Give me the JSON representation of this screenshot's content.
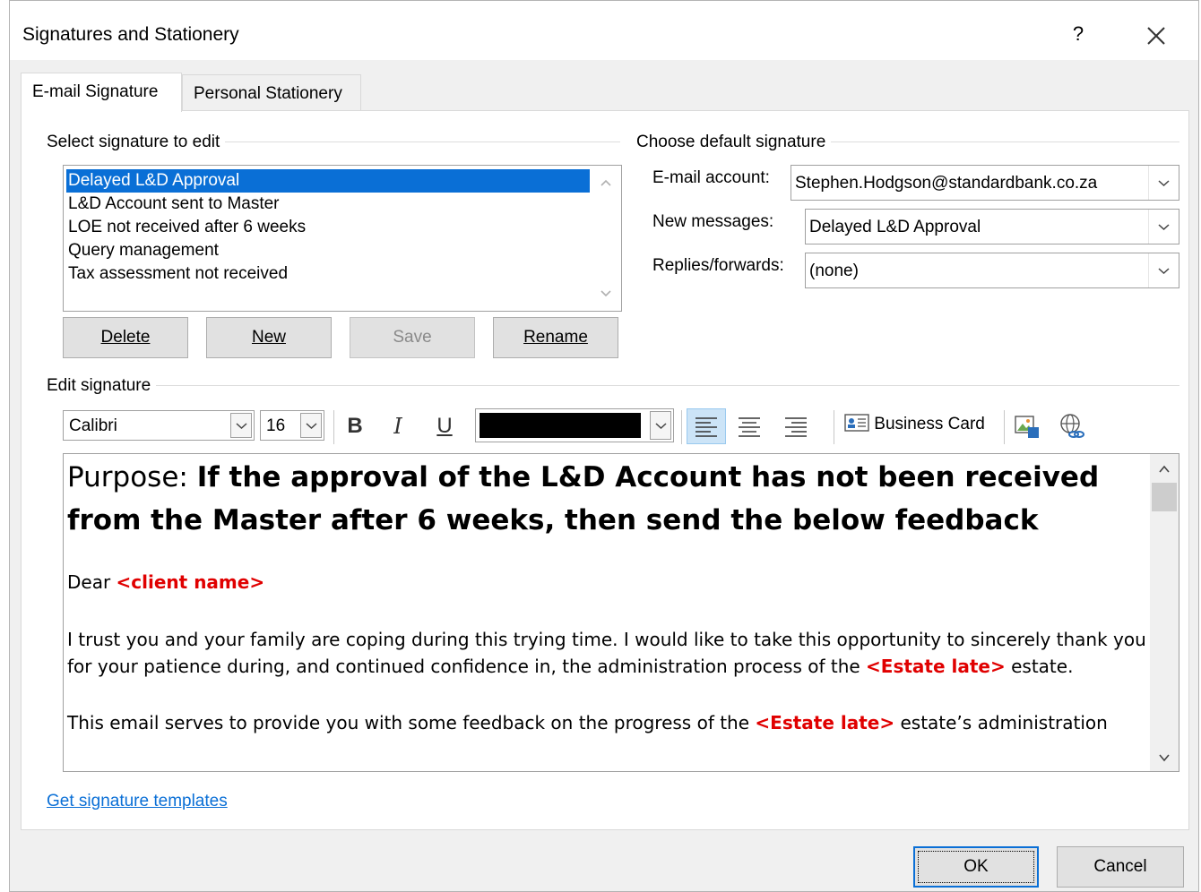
{
  "window": {
    "title": "Signatures and Stationery",
    "help_label": "?"
  },
  "tabs": [
    {
      "label": "E-mail Signature"
    },
    {
      "label": "Personal Stationery"
    }
  ],
  "select_signature": {
    "group_label": "Select signature to edit",
    "items": [
      {
        "label": "Delayed L&D Approval",
        "selected": true
      },
      {
        "label": "L&D Account sent to Master"
      },
      {
        "label": "LOE not received after 6 weeks"
      },
      {
        "label": "Query management"
      },
      {
        "label": "Tax assessment not received"
      }
    ],
    "buttons": {
      "delete": "Delete",
      "new": "New",
      "save": "Save",
      "rename": "Rename"
    }
  },
  "default_signature": {
    "group_label": "Choose default signature",
    "email_account_label": "E-mail account:",
    "email_account_value": "Stephen.Hodgson@standardbank.co.za",
    "new_messages_label": "New messages:",
    "new_messages_value": "Delayed L&D Approval",
    "replies_label": "Replies/forwards:",
    "replies_value": "(none)"
  },
  "edit_signature": {
    "group_label": "Edit signature",
    "font_name": "Calibri",
    "font_size": "16",
    "bold_label": "B",
    "italic_label": "I",
    "underline_label": "U",
    "font_color": "#000000",
    "business_card_label": "Business Card",
    "content": {
      "purpose_prefix": "Purpose: ",
      "purpose_bold": "If the approval of the L&D Account has not been received from the Master after 6 weeks, then send the below feedback",
      "greeting_prefix": "Dear ",
      "greeting_placeholder": "<client name>",
      "para1_a": "I trust you and your family are coping during this trying time. I would like to take this opportunity to sincerely thank you for your patience during, and continued confidence in, the administration process of the ",
      "para1_placeholder": "<Estate late>",
      "para1_b": " estate.",
      "para2_a": "This email serves to provide you with some feedback on the progress of the ",
      "para2_placeholder": "<Estate late>",
      "para2_b": " estate’s administration"
    }
  },
  "templates_link": "Get signature templates",
  "footer": {
    "ok": "OK",
    "cancel": "Cancel"
  },
  "colors": {
    "selection": "#0a6fd6",
    "placeholder_red": "#e00000",
    "link": "#0a6fd6"
  }
}
